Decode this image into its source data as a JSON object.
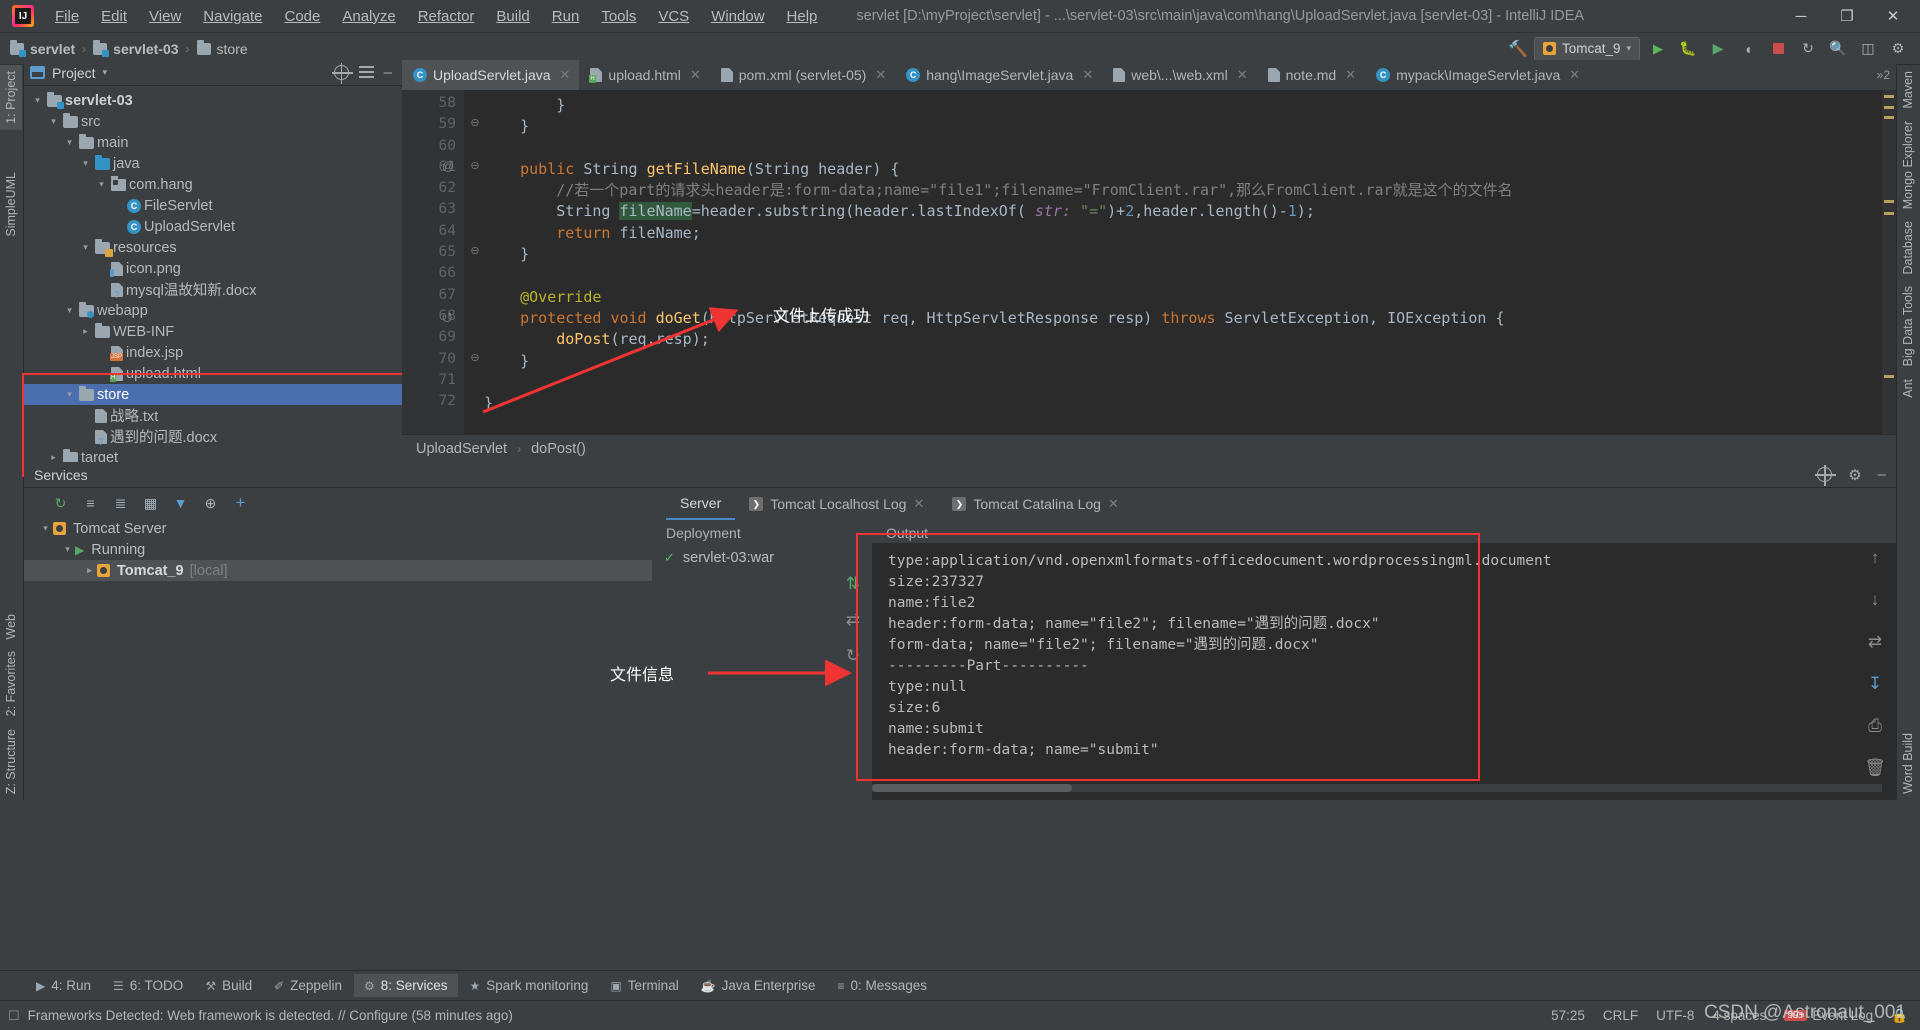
{
  "titlebar": {
    "app_icon": "intellij-logo",
    "menus": [
      "File",
      "Edit",
      "View",
      "Navigate",
      "Code",
      "Analyze",
      "Refactor",
      "Build",
      "Run",
      "Tools",
      "VCS",
      "Window",
      "Help"
    ],
    "window_title": "servlet [D:\\myProject\\servlet] - ...\\servlet-03\\src\\main\\java\\com\\hang\\UploadServlet.java [servlet-03] - IntelliJ IDEA",
    "minimize": "─",
    "maximize": "❐",
    "close": "✕"
  },
  "navbar": {
    "crumbs": [
      "servlet",
      "servlet-03",
      "store"
    ],
    "separator": "›",
    "run_config": "Tomcat_9",
    "hammer_icon": "build-hammer-icon",
    "run_icon": "run-icon",
    "debug_icon": "debug-icon",
    "profile_icon": "profile-icon",
    "coverage_icon": "coverage-icon",
    "stop_icon": "stop-icon",
    "layout_icon": "layout-icon",
    "search_icon": "search-everywhere-icon"
  },
  "left_strip": {
    "tabs": [
      "1: Project",
      "SimpleUML"
    ],
    "bottom_tabs": [
      "Z: Structure",
      "2: Favorites",
      "Web"
    ]
  },
  "right_strip": {
    "tabs": [
      "Maven",
      "Mongo Explorer",
      "Database",
      "Big Data Tools",
      "Ant",
      "Word Build"
    ]
  },
  "project_panel": {
    "title": "Project",
    "caret": "▾",
    "locate_icon": "locate-icon",
    "collapse_icon": "collapse-all-icon",
    "tree": [
      {
        "label": "servlet-03",
        "indent": 0,
        "arrow": "▾",
        "icon": "module-folder",
        "bold": true,
        "selected": false
      },
      {
        "label": "src",
        "indent": 1,
        "arrow": "▾",
        "icon": "folder",
        "bold": false,
        "selected": false
      },
      {
        "label": "main",
        "indent": 2,
        "arrow": "▾",
        "icon": "folder",
        "bold": false,
        "selected": false
      },
      {
        "label": "java",
        "indent": 3,
        "arrow": "▾",
        "icon": "source-folder",
        "bold": false,
        "selected": false
      },
      {
        "label": "com.hang",
        "indent": 4,
        "arrow": "▾",
        "icon": "package",
        "bold": false,
        "selected": false
      },
      {
        "label": "FileServlet",
        "indent": 5,
        "arrow": "",
        "icon": "java-class",
        "bold": false,
        "selected": false
      },
      {
        "label": "UploadServlet",
        "indent": 5,
        "arrow": "",
        "icon": "java-class",
        "bold": false,
        "selected": false
      },
      {
        "label": "resources",
        "indent": 3,
        "arrow": "▾",
        "icon": "resources-folder",
        "bold": false,
        "selected": false
      },
      {
        "label": "icon.png",
        "indent": 4,
        "arrow": "",
        "icon": "image-file",
        "bold": false,
        "selected": false
      },
      {
        "label": "mysql温故知新.docx",
        "indent": 4,
        "arrow": "",
        "icon": "unknown-file",
        "bold": false,
        "selected": false
      },
      {
        "label": "webapp",
        "indent": 2,
        "arrow": "▾",
        "icon": "webapp-folder",
        "bold": false,
        "selected": false
      },
      {
        "label": "WEB-INF",
        "indent": 3,
        "arrow": "▸",
        "icon": "folder",
        "bold": false,
        "selected": false
      },
      {
        "label": "index.jsp",
        "indent": 4,
        "arrow": "",
        "icon": "jsp-file",
        "bold": false,
        "selected": false
      },
      {
        "label": "upload.html",
        "indent": 4,
        "arrow": "",
        "icon": "html-file",
        "bold": false,
        "selected": false
      },
      {
        "label": "store",
        "indent": 2,
        "arrow": "▾",
        "icon": "folder",
        "bold": false,
        "selected": true
      },
      {
        "label": "战略.txt",
        "indent": 3,
        "arrow": "",
        "icon": "text-file",
        "bold": false,
        "selected": false
      },
      {
        "label": "遇到的问题.docx",
        "indent": 3,
        "arrow": "",
        "icon": "unknown-file",
        "bold": false,
        "selected": false
      },
      {
        "label": "target",
        "indent": 1,
        "arrow": "▸",
        "icon": "folder",
        "bold": false,
        "selected": false
      }
    ],
    "services_label": "Services"
  },
  "editor": {
    "tabs": [
      {
        "label": "UploadServlet.java",
        "icon": "java-class",
        "active": true
      },
      {
        "label": "upload.html",
        "icon": "html-file",
        "active": false
      },
      {
        "label": "pom.xml (servlet-05)",
        "icon": "maven-file",
        "active": false
      },
      {
        "label": "hang\\ImageServlet.java",
        "icon": "java-class",
        "active": false
      },
      {
        "label": "web\\...\\web.xml",
        "icon": "xml-file",
        "active": false
      },
      {
        "label": "note.md",
        "icon": "markdown-file",
        "active": false
      },
      {
        "label": "mypack\\ImageServlet.java",
        "icon": "java-class",
        "active": false
      }
    ],
    "tabs_overflow": "»2",
    "close_icon": "✕",
    "line_numbers": [
      "58",
      "59",
      "60",
      "61",
      "62",
      "63",
      "64",
      "65",
      "66",
      "67",
      "68",
      "69",
      "70",
      "71",
      "72"
    ],
    "lines": [
      {
        "n": "58",
        "text": "        }",
        "gutter": "",
        "fold": ""
      },
      {
        "n": "59",
        "text": "    }",
        "gutter": "",
        "fold": "⊖"
      },
      {
        "n": "60",
        "text": "",
        "gutter": "",
        "fold": ""
      },
      {
        "n": "61",
        "text": "    public String getFileName(String header) {",
        "gutter": "@",
        "fold": "⊖"
      },
      {
        "n": "62",
        "text": "        //若一个part的请求头header是:form-data;name=\"file1\";filename=\"FromClient.rar\",那么FromClient.rar就是这个的文件名",
        "gutter": "",
        "fold": ""
      },
      {
        "n": "63",
        "text": "        String fileName=header.substring(header.lastIndexOf( str: \"=\")+2,header.length()-1);",
        "gutter": "",
        "fold": ""
      },
      {
        "n": "64",
        "text": "        return fileName;",
        "gutter": "",
        "fold": ""
      },
      {
        "n": "65",
        "text": "    }",
        "gutter": "",
        "fold": "⊖"
      },
      {
        "n": "66",
        "text": "",
        "gutter": "",
        "fold": ""
      },
      {
        "n": "67",
        "text": "    @Override",
        "gutter": "",
        "fold": ""
      },
      {
        "n": "68",
        "text": "    protected void doGet(HttpServletRequest req, HttpServletResponse resp) throws ServletException, IOException {",
        "gutter": "●↑",
        "fold": ""
      },
      {
        "n": "69",
        "text": "        doPost(req,resp);",
        "gutter": "",
        "fold": ""
      },
      {
        "n": "70",
        "text": "    }",
        "gutter": "",
        "fold": "⊖"
      },
      {
        "n": "71",
        "text": "",
        "gutter": "",
        "fold": ""
      },
      {
        "n": "72",
        "text": "}",
        "gutter": "",
        "fold": ""
      }
    ],
    "breadcrumb": [
      "UploadServlet",
      "doPost()"
    ],
    "breadcrumb_sep": "›"
  },
  "services": {
    "title": "Services",
    "toolbar_icons": [
      "rerun-icon",
      "expand-all-icon",
      "collapse-all-icon",
      "group-icon",
      "filter-icon",
      "show-icon",
      "add-icon"
    ],
    "settings_icon": "gear-icon",
    "locate_icon": "locate-icon",
    "minimize_icon": "─",
    "tree": [
      {
        "label": "Tomcat Server",
        "indent": 0,
        "arrow": "▾",
        "icon": "tomcat-icon",
        "selected": false,
        "suffix": ""
      },
      {
        "label": "Running",
        "indent": 1,
        "arrow": "▾",
        "icon": "running-icon",
        "selected": false,
        "suffix": ""
      },
      {
        "label": "Tomcat_9",
        "indent": 2,
        "arrow": "▸",
        "icon": "tomcat-icon",
        "selected": true,
        "suffix": "[local]"
      }
    ],
    "tabs": [
      {
        "label": "Server",
        "active": true
      },
      {
        "label": "Tomcat Localhost Log",
        "active": false
      },
      {
        "label": "Tomcat Catalina Log",
        "active": false
      }
    ],
    "deployment_title": "Deployment",
    "deployment_items": [
      {
        "label": "servlet-03:war",
        "status": "ok"
      }
    ],
    "output_title": "Output",
    "output_lines": [
      "type:application/vnd.openxmlformats-officedocument.wordprocessingml.document",
      "size:237327",
      "name:file2",
      "header:form-data; name=\"file2\"; filename=\"遇到的问题.docx\"",
      "form-data; name=\"file2\"; filename=\"遇到的问题.docx\"",
      "---------Part----------",
      "type:null",
      "size:6",
      "name:submit",
      "header:form-data; name=\"submit\""
    ],
    "side_icons": [
      "redeploy-icon",
      "undeploy-icon",
      "restart-icon"
    ],
    "right_icons": [
      "scroll-up-icon",
      "scroll-down-icon",
      "soft-wrap-icon",
      "scroll-end-icon",
      "print-icon",
      "delete-icon"
    ]
  },
  "tool_tabs": [
    {
      "label": "4: Run",
      "icon": "run-icon",
      "active": false
    },
    {
      "label": "6: TODO",
      "icon": "todo-icon",
      "active": false
    },
    {
      "label": "Build",
      "icon": "build-icon",
      "active": false
    },
    {
      "label": "Zeppelin",
      "icon": "zeppelin-icon",
      "active": false
    },
    {
      "label": "8: Services",
      "icon": "services-icon",
      "active": true
    },
    {
      "label": "Spark monitoring",
      "icon": "spark-icon",
      "active": false
    },
    {
      "label": "Terminal",
      "icon": "terminal-icon",
      "active": false
    },
    {
      "label": "Java Enterprise",
      "icon": "java-enterprise-icon",
      "active": false
    },
    {
      "label": "0: Messages",
      "icon": "messages-icon",
      "active": false
    }
  ],
  "statusbar": {
    "message": "Frameworks Detected: Web framework is detected. // Configure (58 minutes ago)",
    "caret": "57:25",
    "line_sep": "CRLF",
    "encoding": "UTF-8",
    "indent": "4 spaces",
    "event_log": "Event Log",
    "event_badge": "99+"
  },
  "annotations": {
    "upload_success": "文件上传成功",
    "file_info": "文件信息",
    "watermark": "CSDN @Astronaut_001",
    "box_color": "#f03333"
  }
}
